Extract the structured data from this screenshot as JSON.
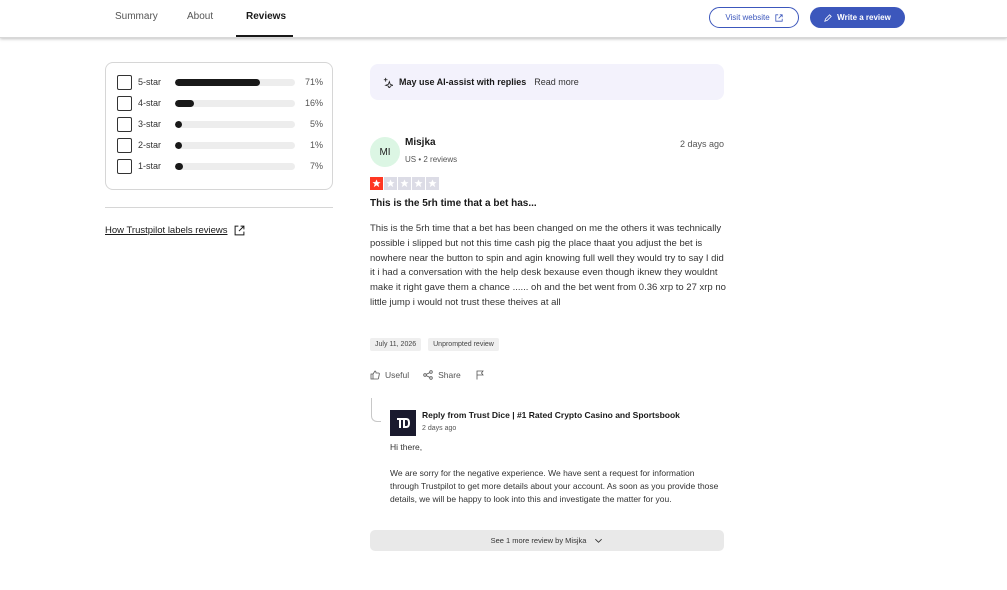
{
  "nav": {
    "tabs": [
      {
        "label": "Summary"
      },
      {
        "label": "About"
      },
      {
        "label": "Reviews"
      }
    ],
    "visit_website": "Visit website",
    "write_review": "Write a review"
  },
  "filters": {
    "rows": [
      {
        "label": "5-star",
        "percent": "71%",
        "fill": 0.71
      },
      {
        "label": "4-star",
        "percent": "16%",
        "fill": 0.16
      },
      {
        "label": "3-star",
        "percent": "5%",
        "fill": 0.05
      },
      {
        "label": "2-star",
        "percent": "1%",
        "fill": 0.01
      },
      {
        "label": "1-star",
        "percent": "7%",
        "fill": 0.07
      }
    ],
    "labels_link": "How Trustpilot labels reviews"
  },
  "ai_notice": {
    "text": "May use AI-assist with replies",
    "link": "Read more"
  },
  "review": {
    "avatar_initials": "MI",
    "author": "Misjka",
    "meta": "US • 2 reviews",
    "date": "2 days ago",
    "rating": 1,
    "title": "This is the 5rh time that a bet has...",
    "body": "This is the 5rh time that a bet has been changed on me the others it was technically possible i slipped but not this time cash pig the place thaat you adjust the bet is nowhere near the button to spin and agin knowing full well they would try to say I did it i had a conversation with the help desk bexause even though iknew they wouldnt make it right gave them a chance ...... oh and the bet went from 0.36 xrp to 27 xrp no little jump i would not trust these theives at all",
    "tags": [
      "July 11, 2026",
      "Unprompted review"
    ],
    "actions": {
      "useful": "Useful",
      "share": "Share"
    }
  },
  "reply": {
    "from": "Reply from Trust Dice | #1 Rated Crypto Casino and Sportsbook",
    "date": "2 days ago",
    "greeting": "Hi there,",
    "body": "We are sorry for the negative experience. We have sent a request for information through Trustpilot to get more details about your account. As soon as you provide those details, we will be happy to look into this and investigate the matter for you."
  },
  "see_more": "See 1 more review by Misjka",
  "colors": {
    "brand_blue": "#3c57bc",
    "star_red": "#ff3722",
    "avatar_bg": "#dcf6e4"
  }
}
